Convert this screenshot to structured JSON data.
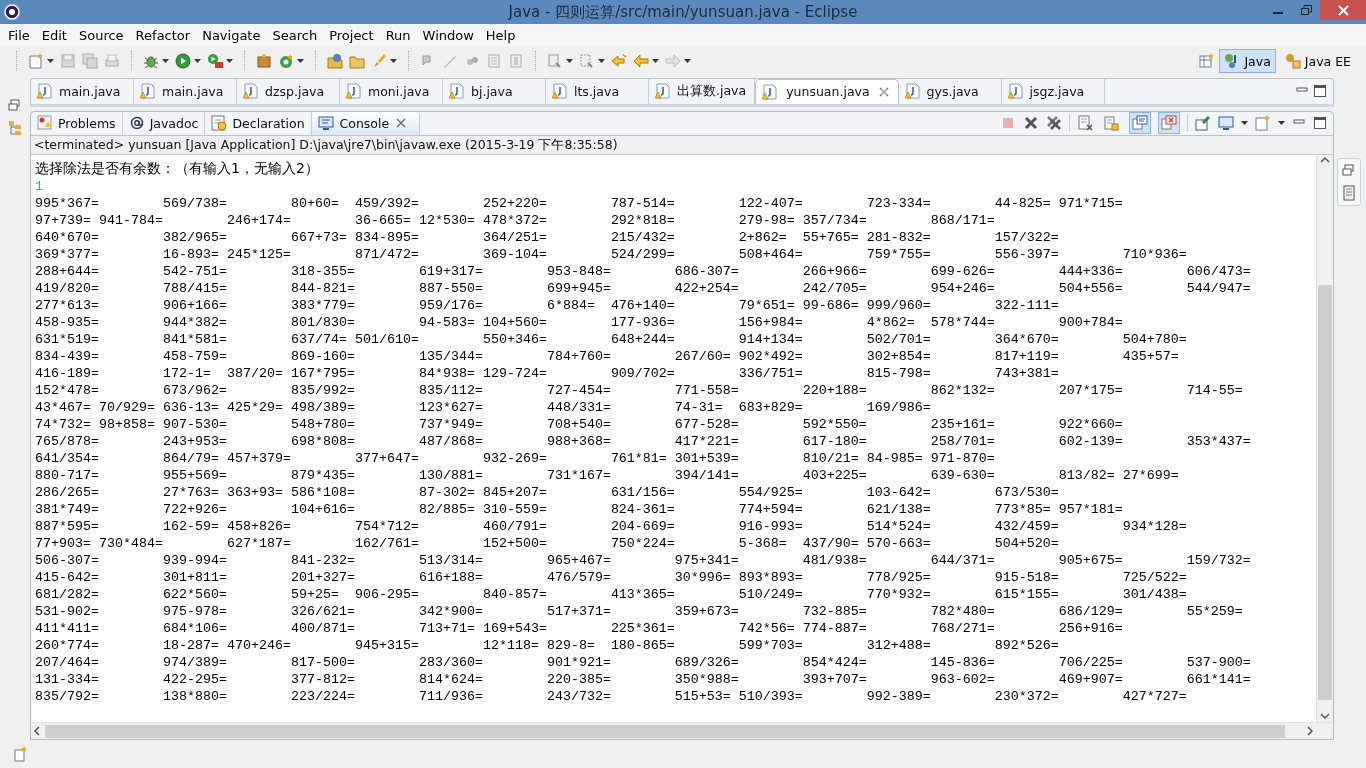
{
  "window": {
    "title": "Java - 四则运算/src/main/yunsuan.java - Eclipse"
  },
  "menu": [
    "File",
    "Edit",
    "Source",
    "Refactor",
    "Navigate",
    "Search",
    "Project",
    "Run",
    "Window",
    "Help"
  ],
  "perspectives": [
    {
      "label": "Java",
      "selected": true
    },
    {
      "label": "Java EE",
      "selected": false
    }
  ],
  "editor_tabs": [
    {
      "label": "main.java",
      "selected": false
    },
    {
      "label": "main.java",
      "selected": false
    },
    {
      "label": "dzsp.java",
      "selected": false
    },
    {
      "label": "moni.java",
      "selected": false
    },
    {
      "label": "bj.java",
      "selected": false
    },
    {
      "label": "lts.java",
      "selected": false
    },
    {
      "label": "出算数.java",
      "selected": false
    },
    {
      "label": "yunsuan.java",
      "selected": true
    },
    {
      "label": "gys.java",
      "selected": false
    },
    {
      "label": "jsgz.java",
      "selected": false
    }
  ],
  "view_tabs": [
    {
      "kind": "problems",
      "label": "Problems",
      "selected": false
    },
    {
      "kind": "javadoc",
      "label": "Javadoc",
      "selected": false
    },
    {
      "kind": "declaration",
      "label": "Declaration",
      "selected": false
    },
    {
      "kind": "console",
      "label": "Console",
      "selected": true
    }
  ],
  "console_toolbar": {
    "toggles": [
      {
        "kind": "scroll-lock",
        "on": false
      },
      {
        "kind": "stdout",
        "on": true
      },
      {
        "kind": "stderr",
        "on": true
      }
    ]
  },
  "console": {
    "header": "<terminated> yunsuan [Java Application] D:\\java\\jre7\\bin\\javaw.exe (2015-3-19 下午8:35:58)",
    "prompt": "选择除法是否有余数：（有输入1，无输入2）",
    "input": "1",
    "lines": [
      [
        "995*367=",
        "569/738=",
        "80+60=",
        "459/392=",
        "252+220=",
        "787-514=",
        "122-407=",
        "723-334=",
        "44-825=",
        "971*715="
      ],
      [
        "97+739=",
        "941-784=",
        "246+174=",
        "36-665=",
        "12*530=",
        "478*372=",
        "292*818=",
        "279-98=",
        "357/734=",
        "868/171="
      ],
      [
        "640*670=",
        "382/965=",
        "667+73=",
        "834-895=",
        "364/251=",
        "215/432=",
        "2+862=",
        "55+765=",
        "281-832=",
        "157/322="
      ],
      [
        "369*377=",
        "16-893=",
        "245*125=",
        "871/472=",
        "369-104=",
        "524/299=",
        "508+464=",
        "759*755=",
        "556-397=",
        "710*936="
      ],
      [
        "288+644=",
        "542-751=",
        "318-355=",
        "619+317=",
        "953-848=",
        "686-307=",
        "266+966=",
        "699-626=",
        "444+336=",
        "606/473="
      ],
      [
        "419/820=",
        "788/415=",
        "844-821=",
        "887-550=",
        "699+945=",
        "422+254=",
        "242/705=",
        "954+246=",
        "504+556=",
        "544/947="
      ],
      [
        "277*613=",
        "906+166=",
        "383*779=",
        "959/176=",
        "6*884=",
        "476+140=",
        "79*651=",
        "99-686=",
        "999/960=",
        "322-111="
      ],
      [
        "458-935=",
        "944*382=",
        "801/830=",
        "94-583=",
        "104+560=",
        "177-936=",
        "156+984=",
        "4*862=",
        "578*744=",
        "900+784="
      ],
      [
        "631*519=",
        "841*581=",
        "637/74=",
        "501/610=",
        "550+346=",
        "648+244=",
        "914+134=",
        "502/701=",
        "364*670=",
        "504+780="
      ],
      [
        "834-439=",
        "458-759=",
        "869-160=",
        "135/344=",
        "784+760=",
        "267/60=",
        "902*492=",
        "302+854=",
        "817+119=",
        "435+57="
      ],
      [
        "416-189=",
        "172-1=",
        "387/20=",
        "167*795=",
        "84*938=",
        "129-724=",
        "909/702=",
        "336/751=",
        "815-798=",
        "743+381="
      ],
      [
        "152*478=",
        "673/962=",
        "835/992=",
        "835/112=",
        "727-454=",
        "771-558=",
        "220+188=",
        "862*132=",
        "207*175=",
        "714-55="
      ],
      [
        "43*467=",
        "70/929=",
        "636-13=",
        "425*29=",
        "498/389=",
        "123*627=",
        "448/331=",
        "74-31=",
        "683+829=",
        "169/986="
      ],
      [
        "74*732=",
        "98+858=",
        "907-530=",
        "548+780=",
        "737*949=",
        "708+540=",
        "677-528=",
        "592*550=",
        "235+161=",
        "922*660="
      ],
      [
        "765/878=",
        "243+953=",
        "698*808=",
        "487/868=",
        "988+368=",
        "417*221=",
        "617-180=",
        "258/701=",
        "602-139=",
        "353*437="
      ],
      [
        "641/354=",
        "864/79=",
        "457+379=",
        "377+647=",
        "932-269=",
        "761*81=",
        "301+539=",
        "810/21=",
        "84-985=",
        "971-870="
      ],
      [
        "880-717=",
        "955+569=",
        "879*435=",
        "130/881=",
        "731*167=",
        "394/141=",
        "403+225=",
        "639-630=",
        "813/82=",
        "27*699="
      ],
      [
        "286/265=",
        "27*763=",
        "363+93=",
        "586*108=",
        "87-302=",
        "845+207=",
        "631/156=",
        "554/925=",
        "103-642=",
        "673/530="
      ],
      [
        "381*749=",
        "722+926=",
        "104+616=",
        "82/885=",
        "310-559=",
        "824-361=",
        "774+594=",
        "621/138=",
        "773*85=",
        "957*181="
      ],
      [
        "887*595=",
        "162-59=",
        "458+826=",
        "754*712=",
        "460/791=",
        "204-669=",
        "916-993=",
        "514*524=",
        "432/459=",
        "934*128="
      ],
      [
        "77+903=",
        "730*484=",
        "627*187=",
        "162/761=",
        "152+500=",
        "750*224=",
        "5-368=",
        "437/90=",
        "570-663=",
        "504+520="
      ],
      [
        "506-307=",
        "939-994=",
        "841-232=",
        "513/314=",
        "965+467=",
        "975+341=",
        "481/938=",
        "644/371=",
        "905+675=",
        "159/732="
      ],
      [
        "415-642=",
        "301+811=",
        "201+327=",
        "616+188=",
        "476/579=",
        "30*996=",
        "893*893=",
        "778/925=",
        "915-518=",
        "725/522="
      ],
      [
        "681/282=",
        "622*560=",
        "59+25=",
        "906-295=",
        "840-857=",
        "413*365=",
        "510/249=",
        "770*932=",
        "615*155=",
        "301/438="
      ],
      [
        "531-902=",
        "975-978=",
        "326/621=",
        "342*900=",
        "517+371=",
        "359+673=",
        "732-885=",
        "782*480=",
        "686/129=",
        "55*259="
      ],
      [
        "411*411=",
        "684*106=",
        "400/871=",
        "713+71=",
        "169+543=",
        "225*361=",
        "742*56=",
        "774-887=",
        "768/271=",
        "256+916="
      ],
      [
        "260*774=",
        "18-287=",
        "470+246=",
        "945+315=",
        "12*118=",
        "829-8=",
        "180-865=",
        "599*703=",
        "312+488=",
        "892*526="
      ],
      [
        "207/464=",
        "974/389=",
        "817-500=",
        "283/360=",
        "901*921=",
        "689/326=",
        "854*424=",
        "145-836=",
        "706/225=",
        "537-900="
      ],
      [
        "131-334=",
        "422-295=",
        "377-812=",
        "814*624=",
        "220-385=",
        "350*988=",
        "393+707=",
        "963-602=",
        "469+907=",
        "661*141="
      ],
      [
        "835/792=",
        "138*880=",
        "223/224=",
        "711/936=",
        "243/732=",
        "515+53=",
        "510/393=",
        "992-389=",
        "230*372=",
        "427*727="
      ]
    ]
  }
}
